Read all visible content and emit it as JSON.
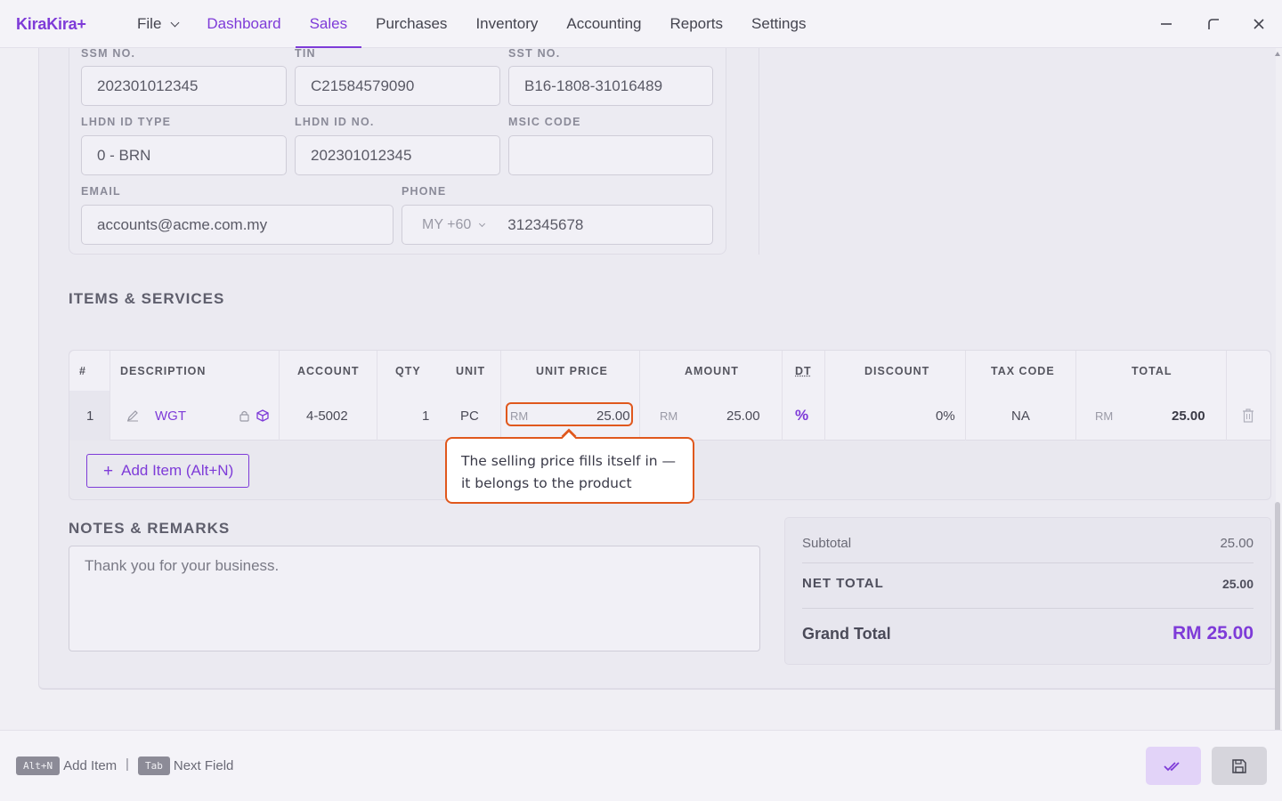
{
  "app": {
    "logo": "KiraKira+"
  },
  "nav": {
    "file": "File",
    "items": [
      "Dashboard",
      "Sales",
      "Purchases",
      "Inventory",
      "Accounting",
      "Reports",
      "Settings"
    ],
    "active": "Sales"
  },
  "customer": {
    "ssm_label": "SSM NO.",
    "ssm_value": "202301012345",
    "tin_label": "TIN",
    "tin_value": "C21584579090",
    "sst_label": "SST NO.",
    "sst_value": "B16-1808-31016489",
    "lhdn_type_label": "LHDN ID TYPE",
    "lhdn_type_value": "0 - BRN",
    "lhdn_no_label": "LHDN ID NO.",
    "lhdn_no_value": "202301012345",
    "msic_label": "MSIC CODE",
    "msic_value": "",
    "email_label": "EMAIL",
    "email_value": "accounts@acme.com.my",
    "phone_label": "PHONE",
    "phone_country": "MY +60",
    "phone_value": "312345678"
  },
  "items": {
    "title": "ITEMS & SERVICES",
    "headers": {
      "num": "#",
      "description": "DESCRIPTION",
      "account": "ACCOUNT",
      "qty": "QTY",
      "unit": "UNIT",
      "unit_price": "UNIT PRICE",
      "amount": "AMOUNT",
      "dt": "DT",
      "discount": "DISCOUNT",
      "tax_code": "TAX CODE",
      "total": "TOTAL"
    },
    "rows": [
      {
        "num": "1",
        "description": "WGT",
        "account": "4-5002",
        "qty": "1",
        "unit": "PC",
        "currency": "RM",
        "unit_price": "25.00",
        "amount": "25.00",
        "dt": "%",
        "discount": "0%",
        "tax_code": "NA",
        "total": "25.00"
      }
    ],
    "add_button": "Add Item (Alt+N)"
  },
  "callout": {
    "text": "The selling price fills itself in — it belongs to the product"
  },
  "notes": {
    "title": "NOTES & REMARKS",
    "value": "Thank you for your business."
  },
  "totals": {
    "subtotal_label": "Subtotal",
    "subtotal_value": "25.00",
    "net_label": "NET TOTAL",
    "net_value": "25.00",
    "grand_label": "Grand Total",
    "grand_value": "RM 25.00"
  },
  "footer": {
    "hint1_key": "Alt+N",
    "hint1_text": "Add Item",
    "separator": "|",
    "hint2_key": "Tab",
    "hint2_text": "Next Field"
  },
  "colors": {
    "accent": "#7e3bd8",
    "callout": "#e0581d"
  }
}
